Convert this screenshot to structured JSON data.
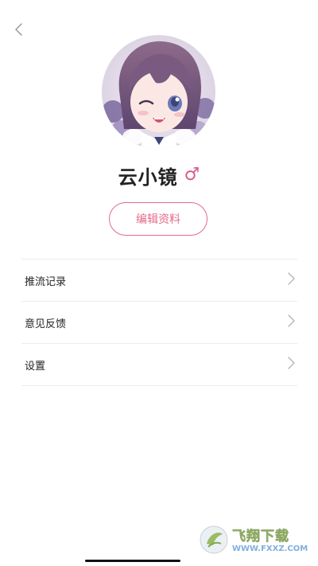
{
  "header": {
    "back_icon": "chevron-left-icon"
  },
  "profile": {
    "avatar_alt": "anime-girl-avatar",
    "name": "云小镜",
    "gender_symbol": "♂",
    "gender_color": "#d85a8f",
    "edit_label": "编辑资料",
    "accent_color": "#e26a8a"
  },
  "menu": {
    "items": [
      {
        "label": "推流记录",
        "icon": "chevron-right-icon"
      },
      {
        "label": "意见反馈",
        "icon": "chevron-right-icon"
      },
      {
        "label": "设置",
        "icon": "chevron-right-icon"
      }
    ]
  },
  "watermark": {
    "title": "飞翔下载",
    "url": "WWW.FXXZ.COM"
  }
}
